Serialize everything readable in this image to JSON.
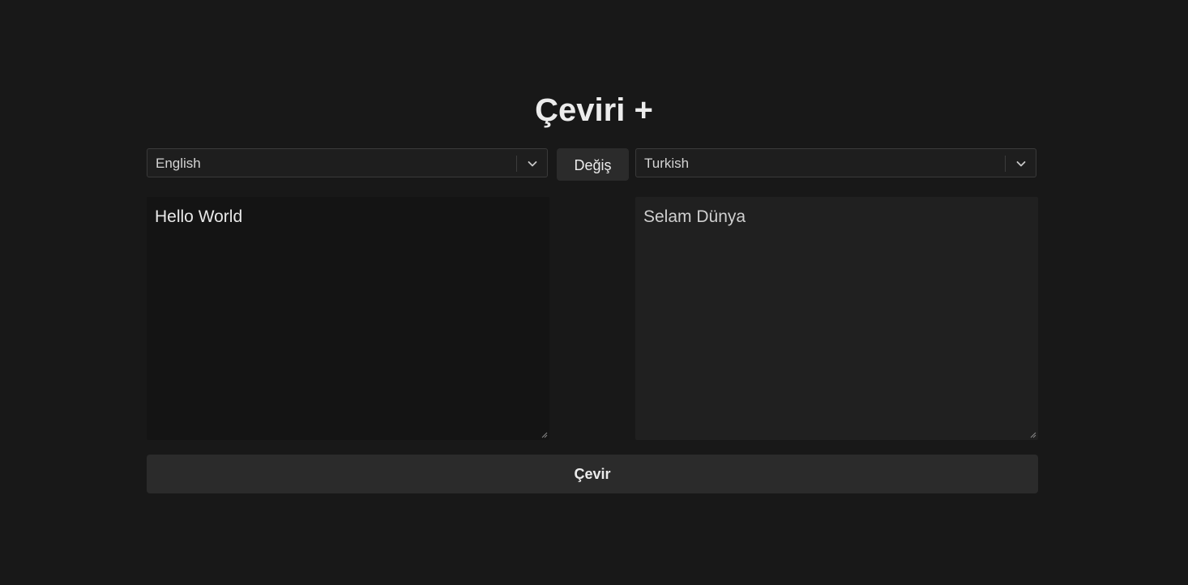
{
  "app": {
    "title": "Çeviri +"
  },
  "source_language": {
    "selected": "English"
  },
  "target_language": {
    "selected": "Turkish"
  },
  "swap_button": {
    "label": "Değiş"
  },
  "source_text": {
    "value": "Hello World"
  },
  "target_text": {
    "value": "Selam Dünya"
  },
  "translate_button": {
    "label": "Çevir"
  },
  "colors": {
    "background": "#181818",
    "button": "#2b2b2b",
    "source_box": "#141414",
    "target_box": "#202020"
  }
}
